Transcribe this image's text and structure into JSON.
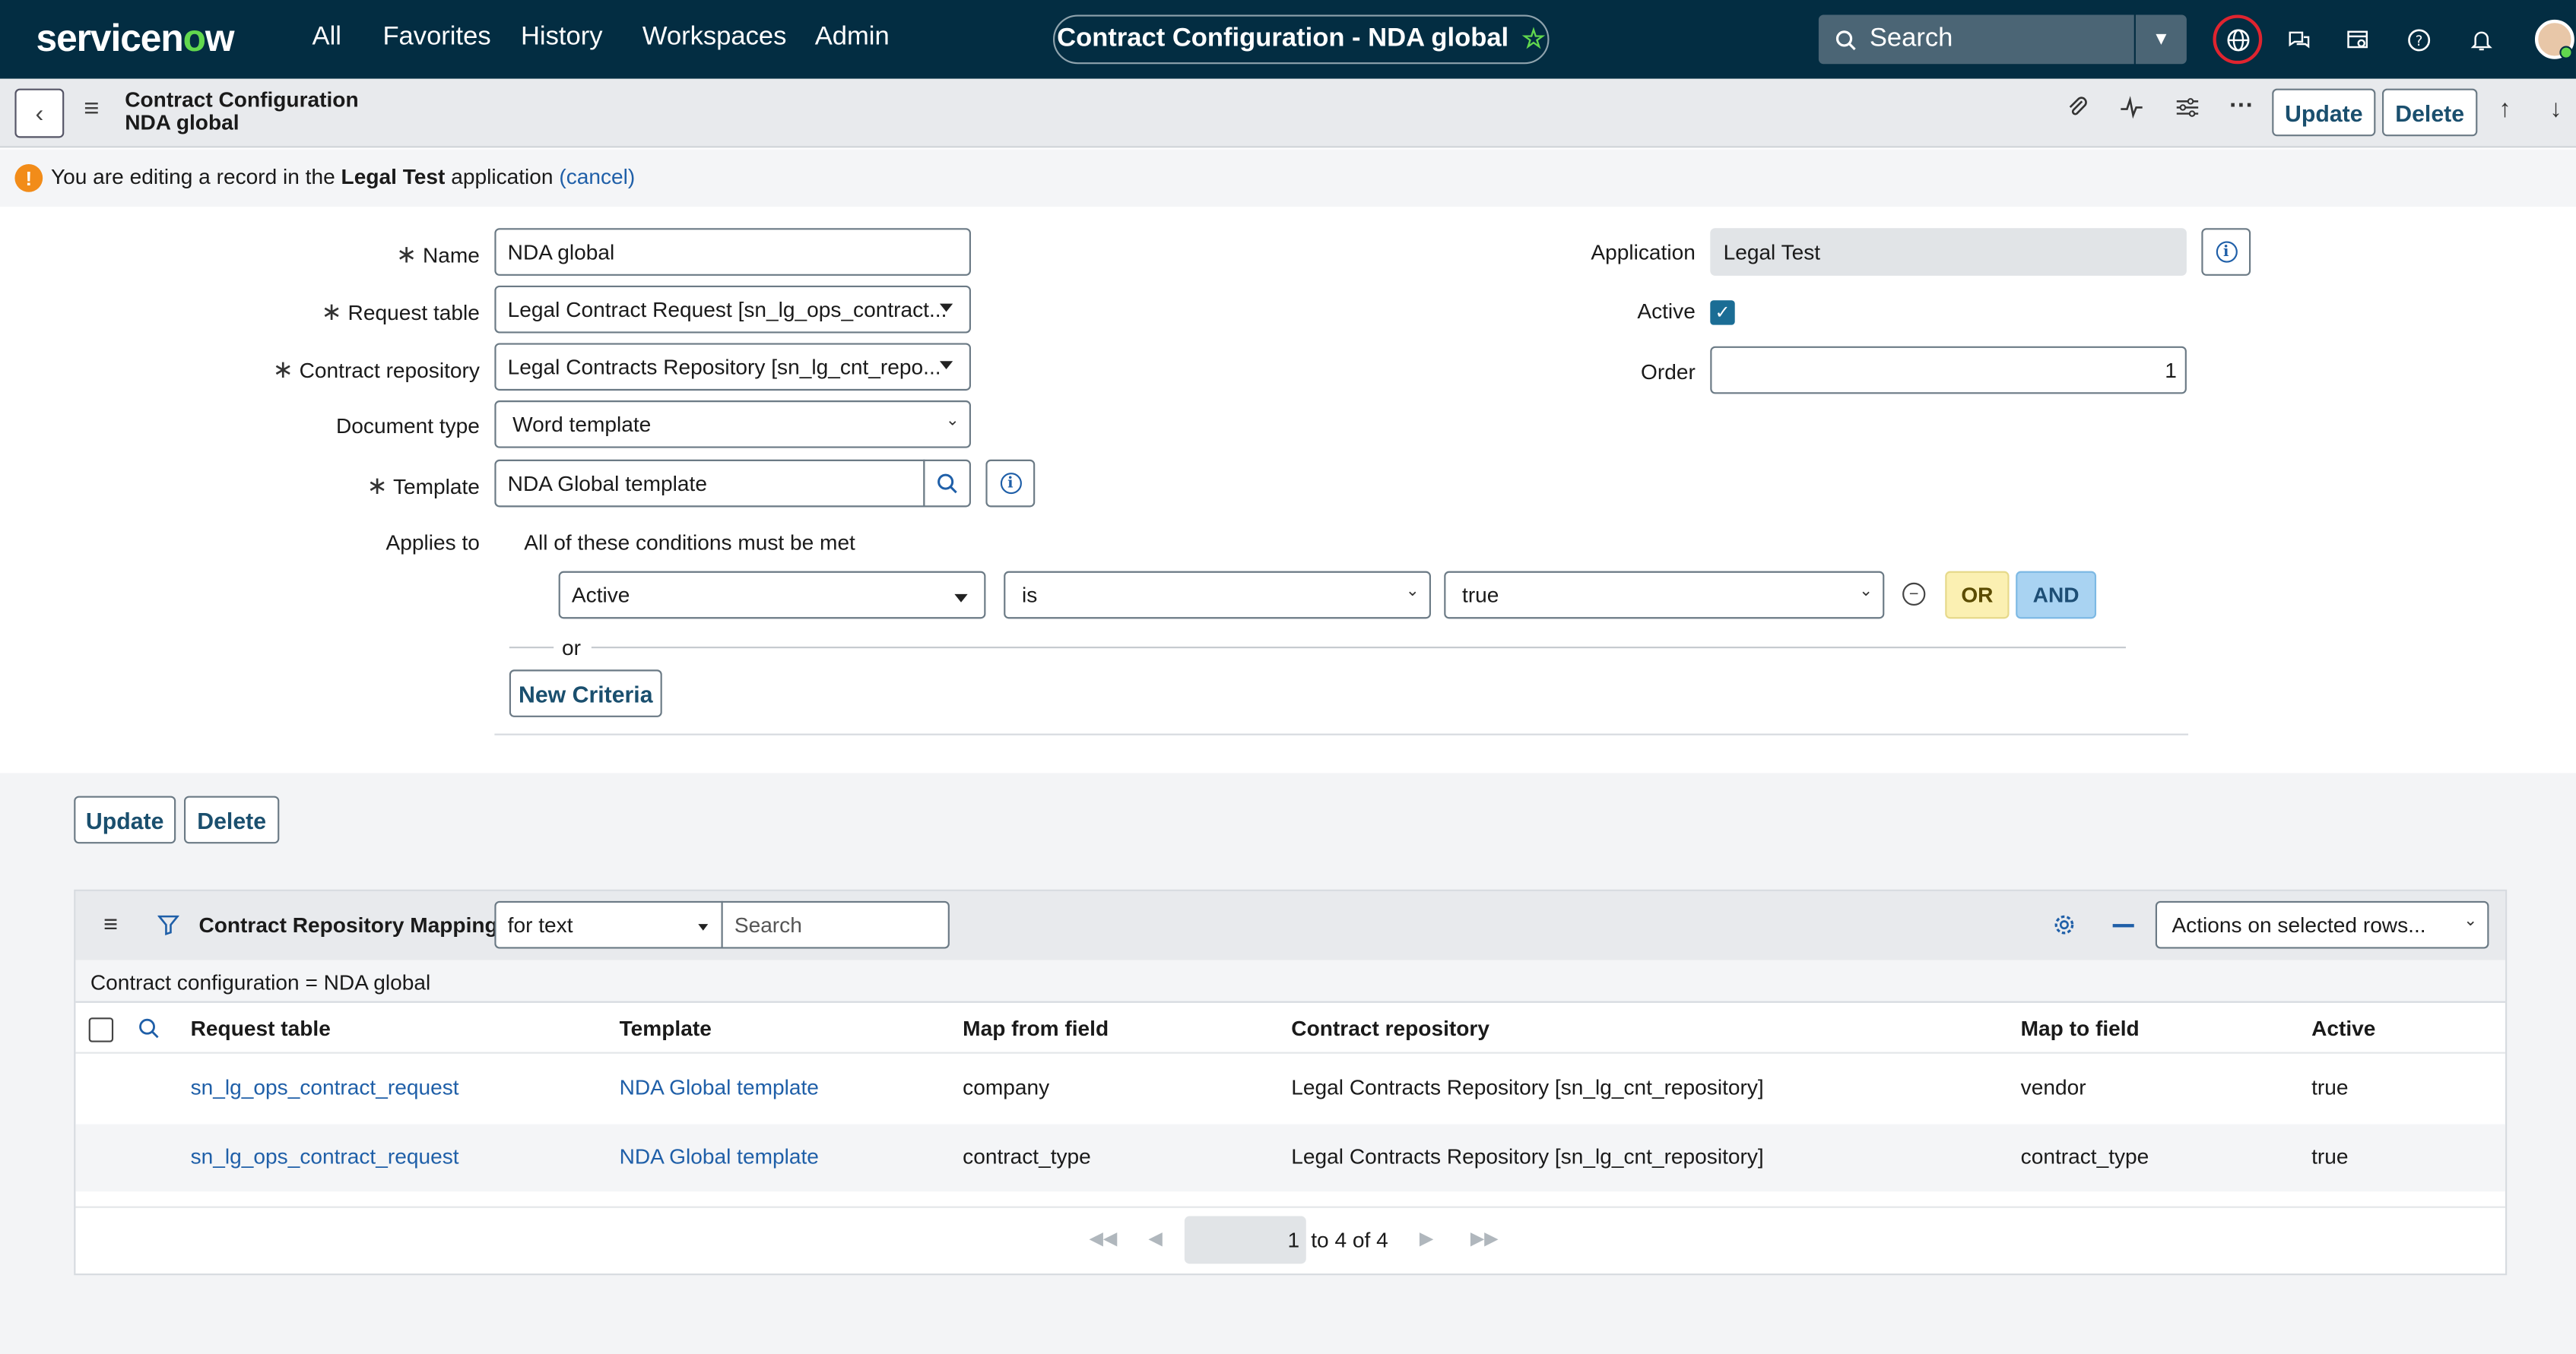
{
  "topnav": {
    "logo_left": "servicen",
    "logo_o": "o",
    "logo_right": "w",
    "items": [
      "All",
      "Favorites",
      "History",
      "Workspaces",
      "Admin"
    ],
    "title": "Contract Configuration - NDA global",
    "search_placeholder": "Search"
  },
  "header": {
    "line1": "Contract Configuration",
    "line2": "NDA global",
    "update_label": "Update",
    "delete_label": "Delete"
  },
  "notice": {
    "prefix": "You are editing a record in the ",
    "app": "Legal Test",
    "suffix": " application ",
    "cancel": "(cancel)"
  },
  "form": {
    "name_label": "Name",
    "name_value": "NDA global",
    "request_table_label": "Request table",
    "request_table_value": "Legal Contract Request [sn_lg_ops_contract...",
    "contract_repo_label": "Contract repository",
    "contract_repo_value": "Legal Contracts Repository [sn_lg_cnt_repo...",
    "doc_type_label": "Document type",
    "doc_type_value": "Word template",
    "template_label": "Template",
    "template_value": "NDA Global template",
    "applies_label": "Applies to",
    "conditions_text": "All of these conditions must be met",
    "cond_field": "Active",
    "cond_op": "is",
    "cond_value": "true",
    "or_label": "OR",
    "and_label": "AND",
    "or_sep": "or",
    "new_criteria": "New Criteria",
    "application_label": "Application",
    "application_value": "Legal Test",
    "active_label": "Active",
    "active_checked": true,
    "order_label": "Order",
    "order_value": "1"
  },
  "bottom_buttons": {
    "update": "Update",
    "delete": "Delete"
  },
  "related_list": {
    "title": "Contract Repository Mappings",
    "filter_select": "for text",
    "search_placeholder": "Search",
    "actions_select": "Actions on selected rows...",
    "condition": "Contract configuration = NDA global",
    "columns": [
      "Request table",
      "Template",
      "Map from field",
      "Contract repository",
      "Map to field",
      "Active"
    ],
    "rows": [
      [
        "sn_lg_ops_contract_request",
        "NDA Global template",
        "company",
        "Legal Contracts Repository [sn_lg_cnt_repository]",
        "vendor",
        "true"
      ],
      [
        "sn_lg_ops_contract_request",
        "NDA Global template",
        "contract_type",
        "Legal Contracts Repository [sn_lg_cnt_repository]",
        "contract_type",
        "true"
      ]
    ],
    "pager_value": "1",
    "pager_text": "to 4 of 4"
  },
  "colors": {
    "nav_bg": "#032d42",
    "accent_green": "#62d84e",
    "link": "#1f5fa8",
    "checkbox": "#1b6d95",
    "or_bg": "#fbf0b2",
    "and_bg": "#a9d3f2"
  }
}
